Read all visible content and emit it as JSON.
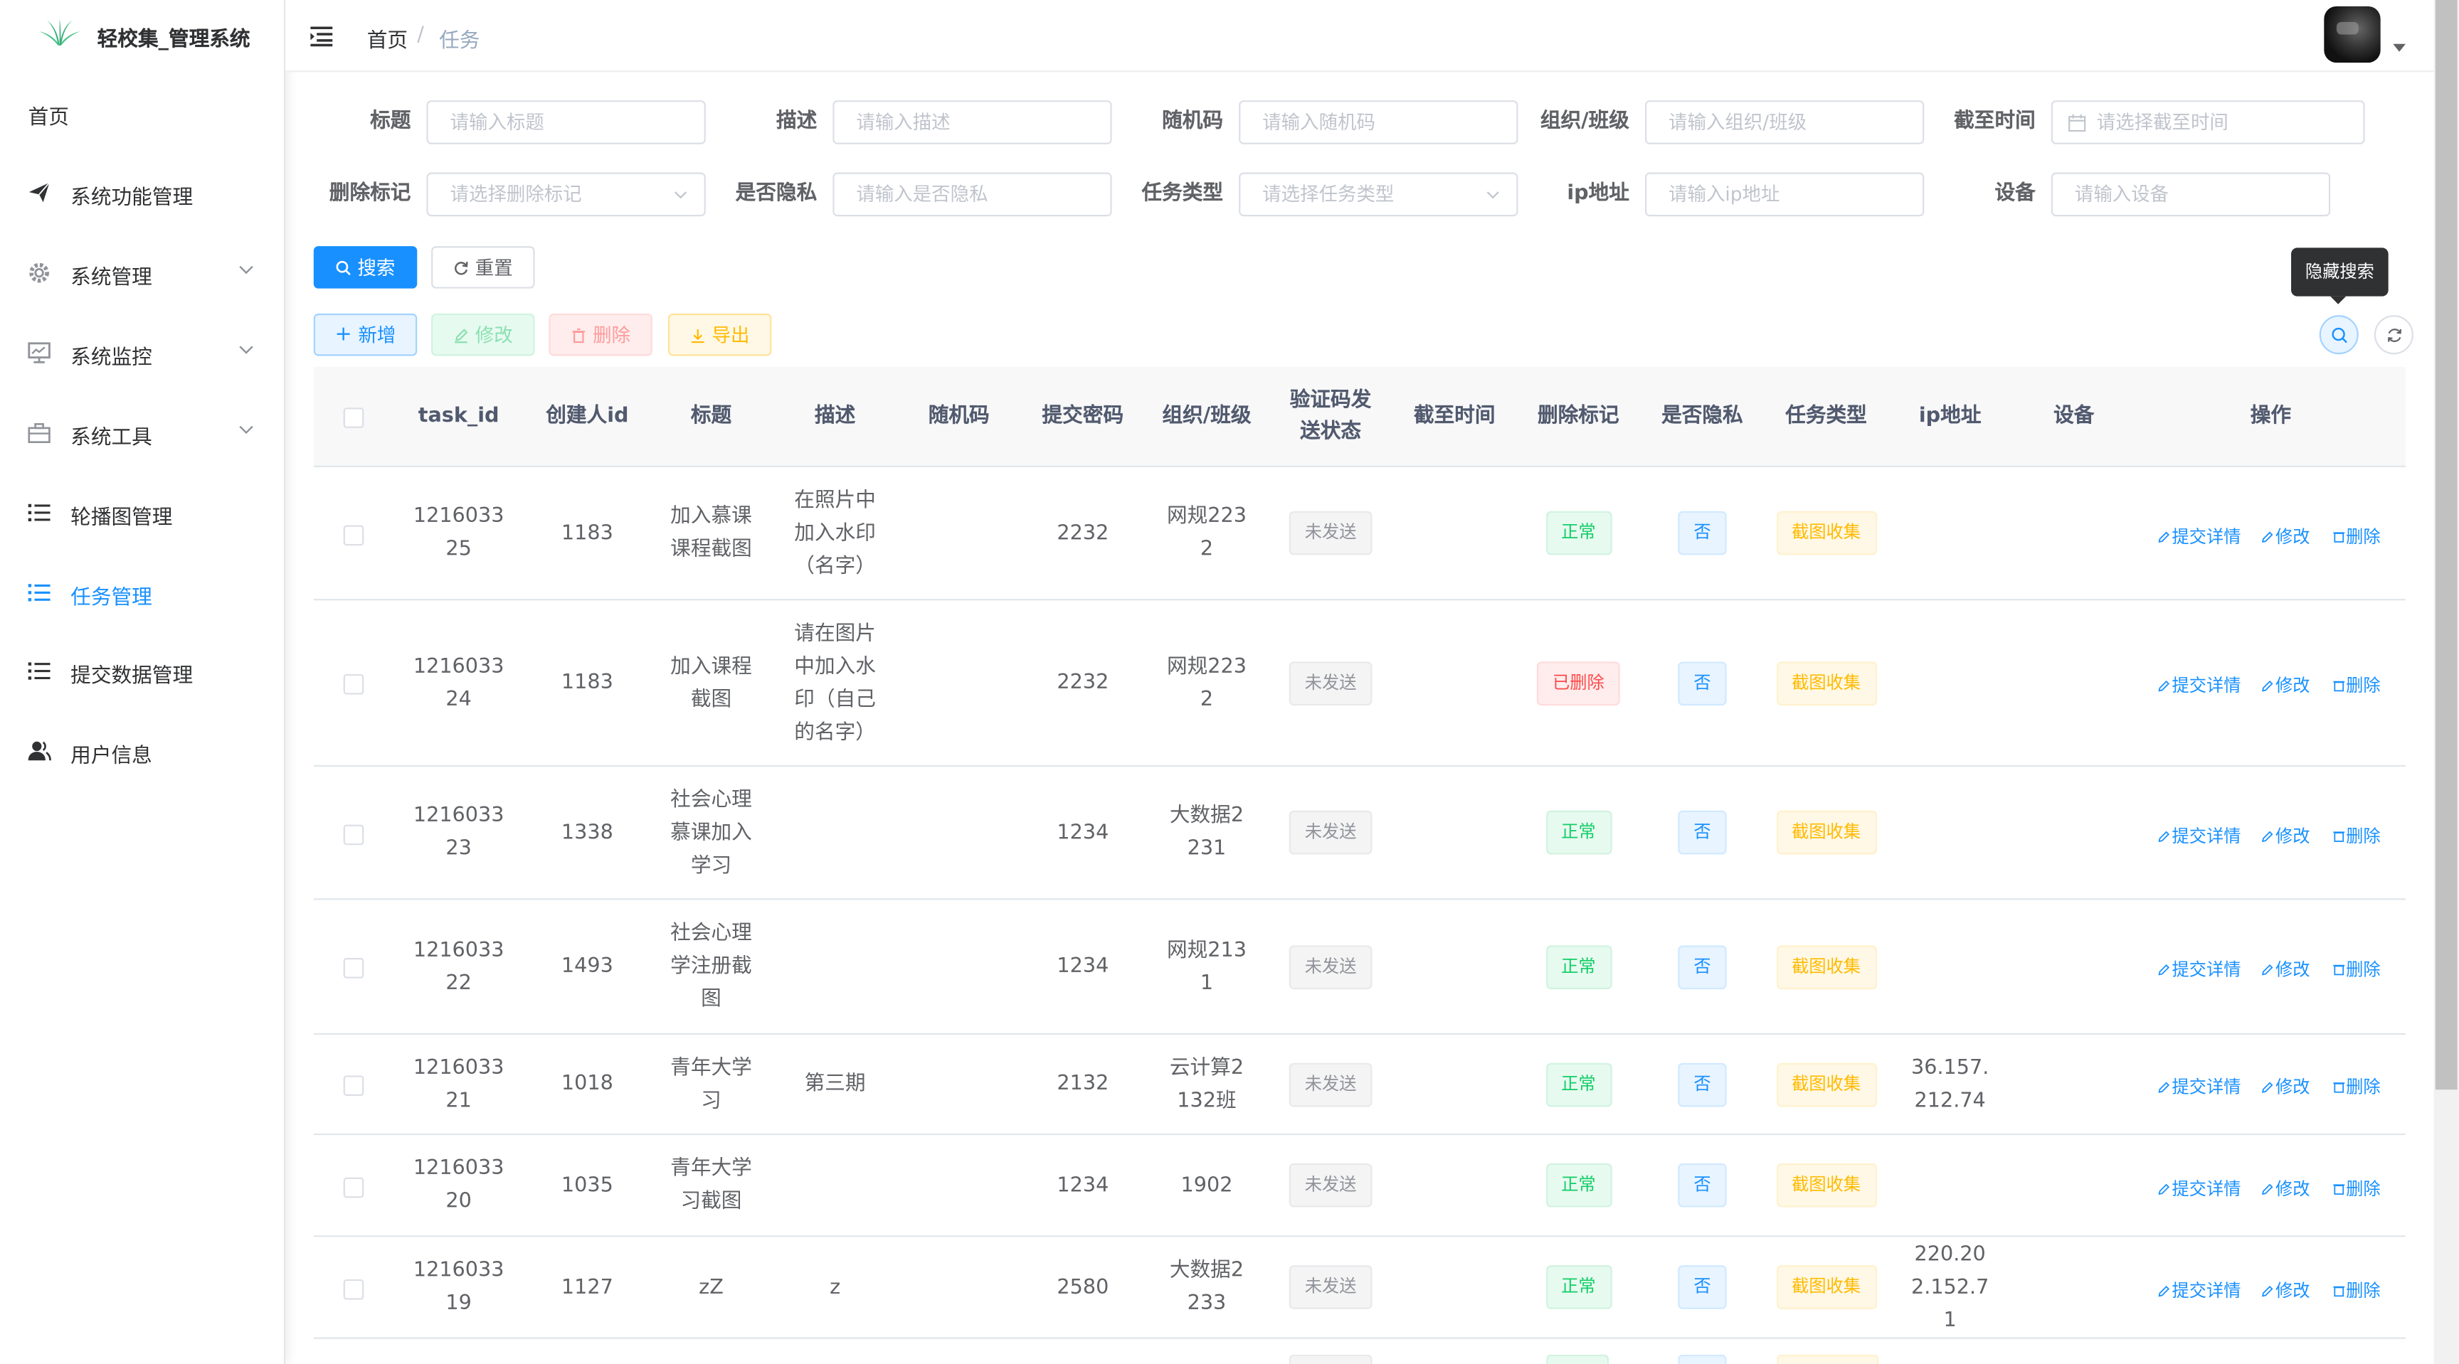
{
  "app": {
    "title": "轻校集_管理系统",
    "logo_icon": "leaf-logo-icon",
    "accent_color": "#1890ff"
  },
  "sidebar": {
    "items": [
      {
        "label": "首页",
        "icon": "",
        "expandable": false,
        "active": false
      },
      {
        "label": "系统功能管理",
        "icon": "send-icon",
        "expandable": false,
        "active": false
      },
      {
        "label": "系统管理",
        "icon": "gear-icon",
        "expandable": true,
        "active": false
      },
      {
        "label": "系统监控",
        "icon": "monitor-icon",
        "expandable": true,
        "active": false
      },
      {
        "label": "系统工具",
        "icon": "toolbox-icon",
        "expandable": true,
        "active": false
      },
      {
        "label": "轮播图管理",
        "icon": "list-icon",
        "expandable": false,
        "active": false
      },
      {
        "label": "任务管理",
        "icon": "list-icon",
        "expandable": false,
        "active": true
      },
      {
        "label": "提交数据管理",
        "icon": "list-icon",
        "expandable": false,
        "active": false
      },
      {
        "label": "用户信息",
        "icon": "user-icon",
        "expandable": false,
        "active": false
      }
    ]
  },
  "breadcrumb": {
    "home": "首页",
    "separator": "/",
    "current": "任务"
  },
  "search_form": {
    "fields": [
      {
        "label": "标题",
        "placeholder": "请输入标题",
        "type": "input"
      },
      {
        "label": "描述",
        "placeholder": "请输入描述",
        "type": "input"
      },
      {
        "label": "随机码",
        "placeholder": "请输入随机码",
        "type": "input"
      },
      {
        "label": "组织/班级",
        "placeholder": "请输入组织/班级",
        "type": "input"
      },
      {
        "label": "截至时间",
        "placeholder": "请选择截至时间",
        "type": "date"
      },
      {
        "label": "删除标记",
        "placeholder": "请选择删除标记",
        "type": "select"
      },
      {
        "label": "是否隐私",
        "placeholder": "请输入是否隐私",
        "type": "input"
      },
      {
        "label": "任务类型",
        "placeholder": "请选择任务类型",
        "type": "select"
      },
      {
        "label": "ip地址",
        "placeholder": "请输入ip地址",
        "type": "input"
      },
      {
        "label": "设备",
        "placeholder": "请输入设备",
        "type": "input"
      }
    ],
    "search_label": "搜索",
    "reset_label": "重置"
  },
  "toolbar": {
    "add_label": "新增",
    "edit_label": "修改",
    "delete_label": "删除",
    "export_label": "导出",
    "tooltip": "隐藏搜索"
  },
  "table": {
    "columns": [
      "task_id",
      "创建人id",
      "标题",
      "描述",
      "随机码",
      "提交密码",
      "组织/班级",
      "验证码发送状态",
      "截至时间",
      "删除标记",
      "是否隐私",
      "任务类型",
      "ip地址",
      "设备",
      "操作"
    ],
    "ops": {
      "detail": "提交详情",
      "edit": "修改",
      "delete": "删除"
    },
    "rows": [
      {
        "task_id": "121603325",
        "creator_id": "1183",
        "title": "加入慕课课程截图",
        "desc": "在照片中加入水印（名字）",
        "random_code": "",
        "password": "2232",
        "org": "网规2232",
        "sms_status": "未发送",
        "deadline": "",
        "deleted": "正常",
        "private": "否",
        "task_type": "截图收集",
        "ip": "",
        "device": ""
      },
      {
        "task_id": "121603324",
        "creator_id": "1183",
        "title": "加入课程截图",
        "desc": "请在图片中加入水印（自己的名字）",
        "random_code": "",
        "password": "2232",
        "org": "网规2232",
        "sms_status": "未发送",
        "deadline": "",
        "deleted": "已删除",
        "private": "否",
        "task_type": "截图收集",
        "ip": "",
        "device": ""
      },
      {
        "task_id": "121603323",
        "creator_id": "1338",
        "title": "社会心理慕课加入学习",
        "desc": "",
        "random_code": "",
        "password": "1234",
        "org": "大数据2231",
        "sms_status": "未发送",
        "deadline": "",
        "deleted": "正常",
        "private": "否",
        "task_type": "截图收集",
        "ip": "",
        "device": ""
      },
      {
        "task_id": "121603322",
        "creator_id": "1493",
        "title": "社会心理学注册截图",
        "desc": "",
        "random_code": "",
        "password": "1234",
        "org": "网规2131",
        "sms_status": "未发送",
        "deadline": "",
        "deleted": "正常",
        "private": "否",
        "task_type": "截图收集",
        "ip": "",
        "device": ""
      },
      {
        "task_id": "121603321",
        "creator_id": "1018",
        "title": "青年大学习",
        "desc": "第三期",
        "random_code": "",
        "password": "2132",
        "org": "云计算2132班",
        "sms_status": "未发送",
        "deadline": "",
        "deleted": "正常",
        "private": "否",
        "task_type": "截图收集",
        "ip": "36.157.212.74",
        "device": ""
      },
      {
        "task_id": "121603320",
        "creator_id": "1035",
        "title": "青年大学习截图",
        "desc": "",
        "random_code": "",
        "password": "1234",
        "org": "1902",
        "sms_status": "未发送",
        "deadline": "",
        "deleted": "正常",
        "private": "否",
        "task_type": "截图收集",
        "ip": "",
        "device": ""
      },
      {
        "task_id": "121603319",
        "creator_id": "1127",
        "title": "zZ",
        "desc": "z",
        "random_code": "",
        "password": "2580",
        "org": "大数据2233",
        "sms_status": "未发送",
        "deadline": "",
        "deleted": "正常",
        "private": "否",
        "task_type": "截图收集",
        "ip": "220.202.152.71",
        "device": ""
      }
    ]
  }
}
